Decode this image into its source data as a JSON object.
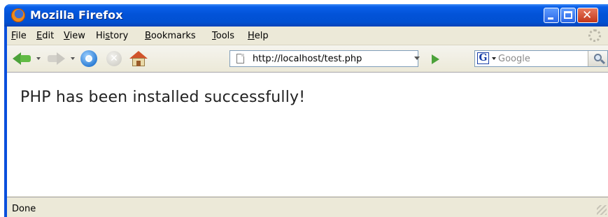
{
  "window": {
    "title": "Mozilla Firefox",
    "close_glyph": "✕"
  },
  "menubar": {
    "items": [
      {
        "accel": "F",
        "rest": "ile"
      },
      {
        "accel": "E",
        "rest": "dit"
      },
      {
        "accel": "V",
        "rest": "iew"
      },
      {
        "pre": "Hi",
        "accel": "s",
        "rest": "tory"
      },
      {
        "accel": "B",
        "rest": "ookmarks"
      },
      {
        "accel": "T",
        "rest": "ools"
      },
      {
        "accel": "H",
        "rest": "elp"
      }
    ]
  },
  "toolbar": {
    "url": "http://localhost/test.php",
    "search_engine_letter": "G",
    "search_placeholder": "Google",
    "stop_glyph": "✕"
  },
  "page": {
    "message": "PHP has been installed successfully!"
  },
  "status": {
    "text": "Done"
  },
  "colors": {
    "titlebar": "#0253d8",
    "chrome": "#ece9d8",
    "accent_green": "#4ca23a"
  }
}
